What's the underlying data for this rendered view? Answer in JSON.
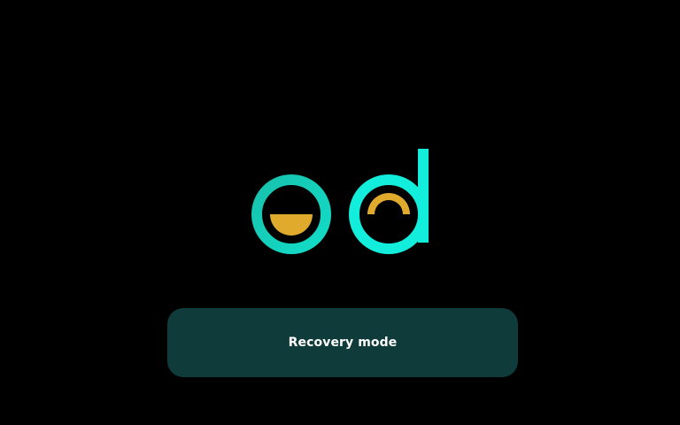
{
  "logo": {
    "icon": "pd-logo-icon",
    "colors": {
      "teal": "#1fc4b0",
      "teal_bright": "#12eddc",
      "gold": "#e0aa2c"
    }
  },
  "recovery_button": {
    "label": "Recovery mode",
    "background": "#0f3b3a",
    "text_color": "#ffffff"
  }
}
